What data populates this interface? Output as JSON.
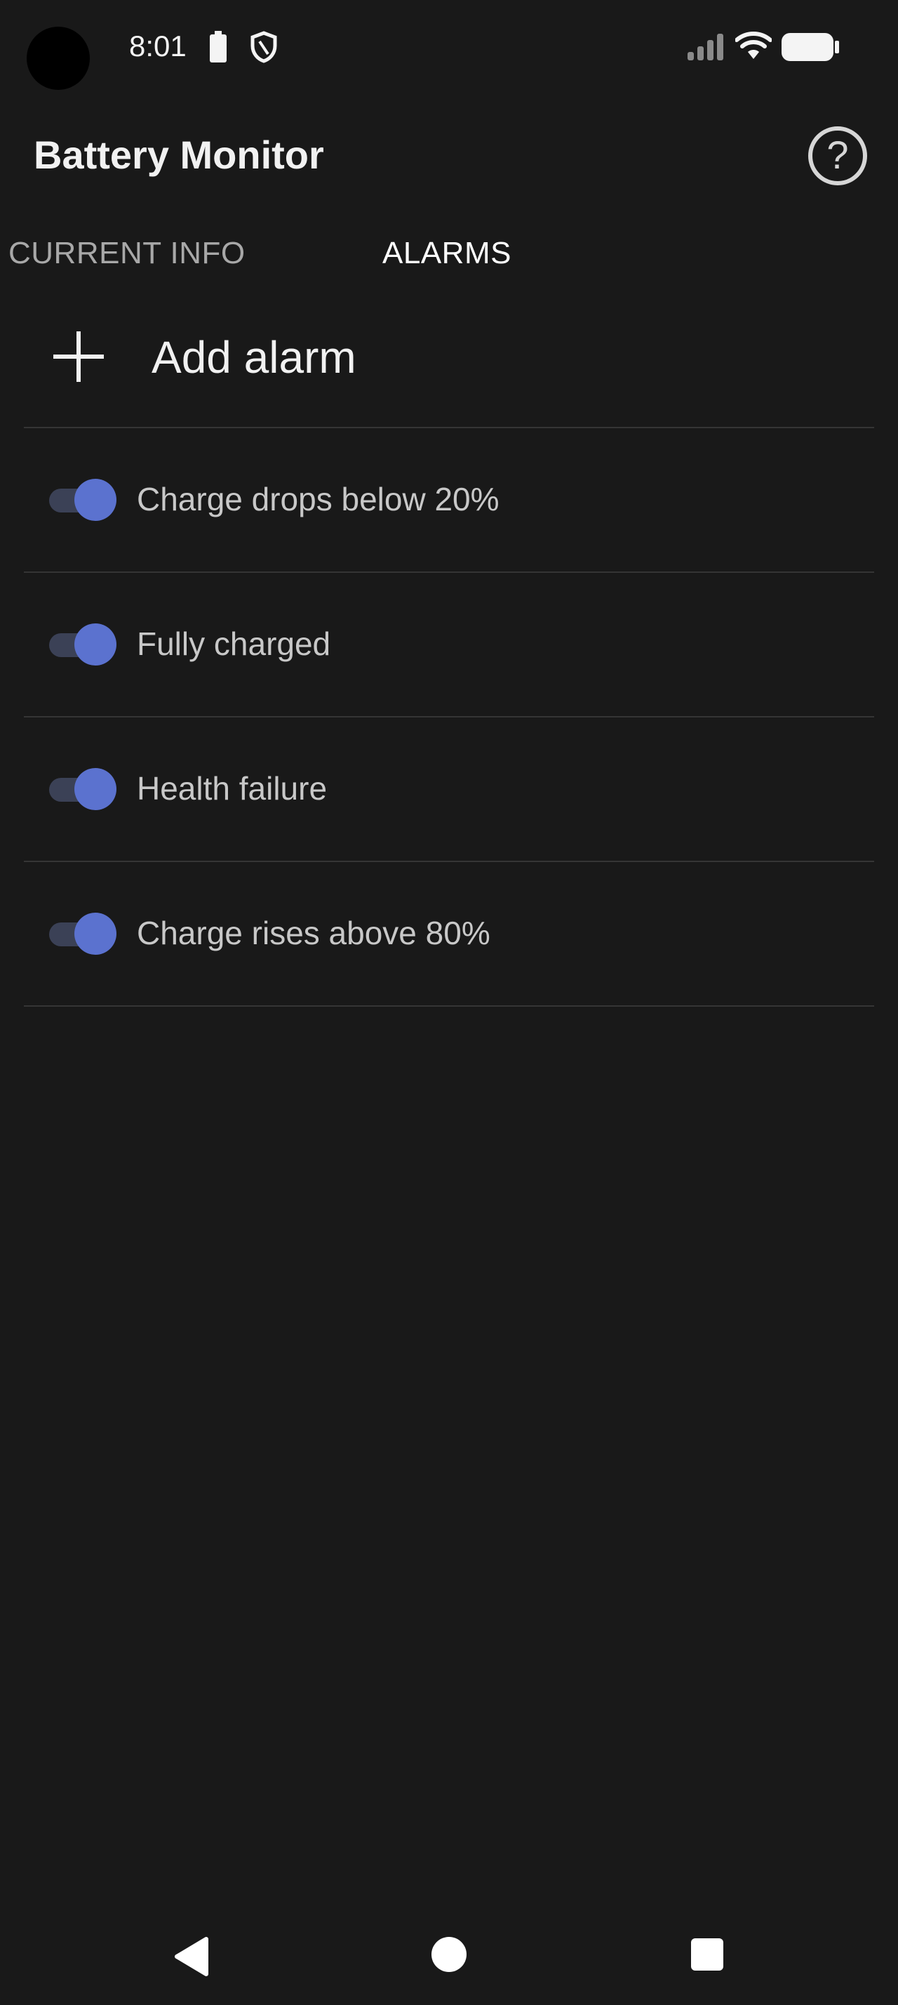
{
  "status_bar": {
    "time": "8:01",
    "icons": [
      "camera-cutout",
      "battery-small-icon",
      "shield-icon",
      "signal-icon",
      "wifi-icon",
      "battery-full-icon"
    ]
  },
  "app_bar": {
    "title": "Battery Monitor",
    "help_icon_glyph": "?"
  },
  "tabs": [
    {
      "label": "CURRENT INFO",
      "selected": false
    },
    {
      "label": "ALARMS",
      "selected": true
    }
  ],
  "add_alarm": {
    "label": "Add alarm"
  },
  "alarms": [
    {
      "label": "Charge drops below 20%",
      "enabled": true
    },
    {
      "label": "Fully charged",
      "enabled": true
    },
    {
      "label": "Health failure",
      "enabled": true
    },
    {
      "label": "Charge rises above 80%",
      "enabled": true
    }
  ],
  "nav_bar": {
    "icons": [
      "back-icon",
      "home-icon",
      "recents-icon"
    ]
  },
  "colors": {
    "background": "#191919",
    "toggle_track": "#3b4156",
    "toggle_thumb": "#5b72cf",
    "divider": "#353535"
  }
}
